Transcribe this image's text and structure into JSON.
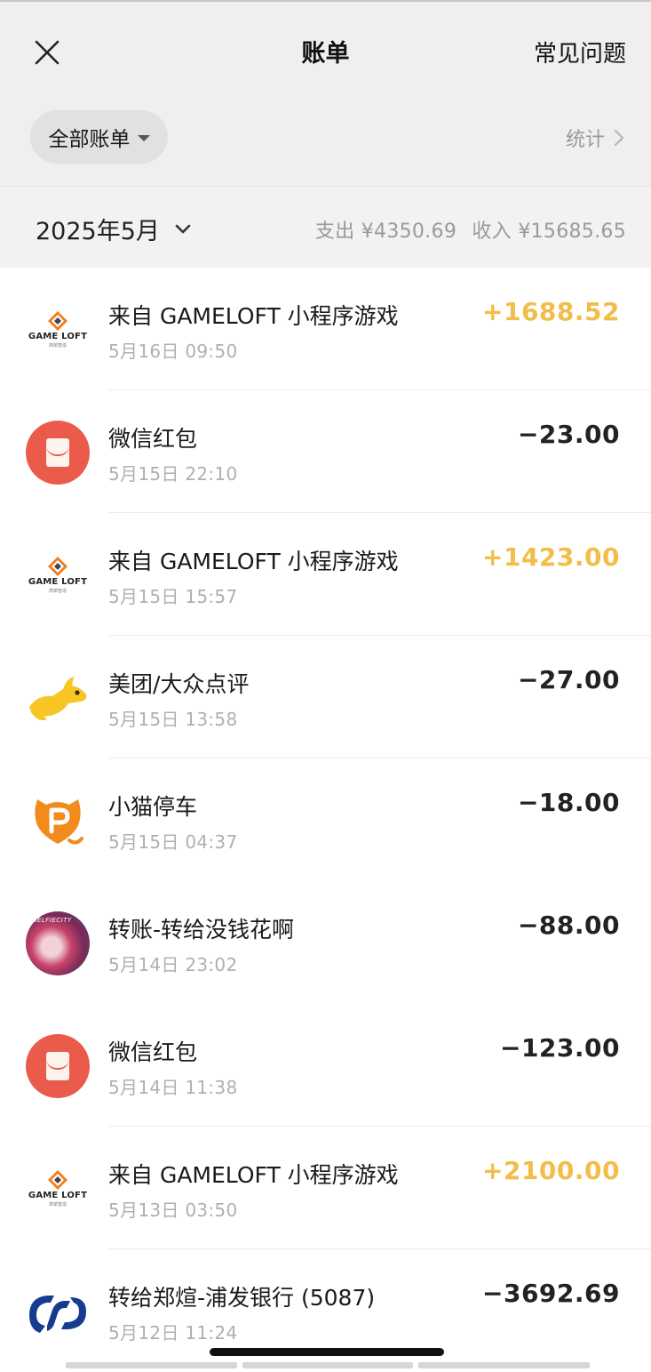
{
  "nav": {
    "title": "账单",
    "faq_label": "常见问题"
  },
  "filter": {
    "selected": "全部账单",
    "stats_label": "统计"
  },
  "month": {
    "label": "2025年5月",
    "expense": "支出 ¥4350.69",
    "income": "收入 ¥15685.65"
  },
  "colors": {
    "income_amount": "#f2bd4a",
    "expense_amount": "#222222",
    "red_packet": "#ea5b4b",
    "meituan": "#f7c524",
    "parking": "#f28a1c",
    "spdb": "#173b8f"
  },
  "transactions": [
    {
      "icon": "gameloft-logo-icon",
      "title": "来自 GAMELOFT 小程序游戏",
      "time": "5月16日 09:50",
      "amount": "+1688.52",
      "type": "income"
    },
    {
      "icon": "red-packet-icon",
      "title": "微信红包",
      "time": "5月15日 22:10",
      "amount": "−23.00",
      "type": "expense"
    },
    {
      "icon": "gameloft-logo-icon",
      "title": "来自 GAMELOFT 小程序游戏",
      "time": "5月15日 15:57",
      "amount": "+1423.00",
      "type": "income"
    },
    {
      "icon": "meituan-kangaroo-icon",
      "title": "美团/大众点评",
      "time": "5月15日 13:58",
      "amount": "−27.00",
      "type": "expense"
    },
    {
      "icon": "parking-p-icon",
      "title": "小猫停车",
      "time": "5月15日 04:37",
      "amount": "−18.00",
      "type": "expense"
    },
    {
      "icon": "contact-avatar-icon",
      "title": "转账-转给没钱花啊",
      "time": "5月14日 23:02",
      "amount": "−88.00",
      "type": "expense"
    },
    {
      "icon": "red-packet-icon",
      "title": "微信红包",
      "time": "5月14日 11:38",
      "amount": "−123.00",
      "type": "expense"
    },
    {
      "icon": "gameloft-logo-icon",
      "title": "来自 GAMELOFT 小程序游戏",
      "time": "5月13日 03:50",
      "amount": "+2100.00",
      "type": "income"
    },
    {
      "icon": "spdb-bank-icon",
      "title": "转给郑煊-浦发银行 (5087)",
      "time": "5月12日 11:24",
      "amount": "−3692.69",
      "type": "expense"
    }
  ],
  "icon_labels": {
    "gameloft": "GAME LOFT",
    "gameloft_sub": "简单智造",
    "avatar_tag": "SELFIECITY"
  }
}
